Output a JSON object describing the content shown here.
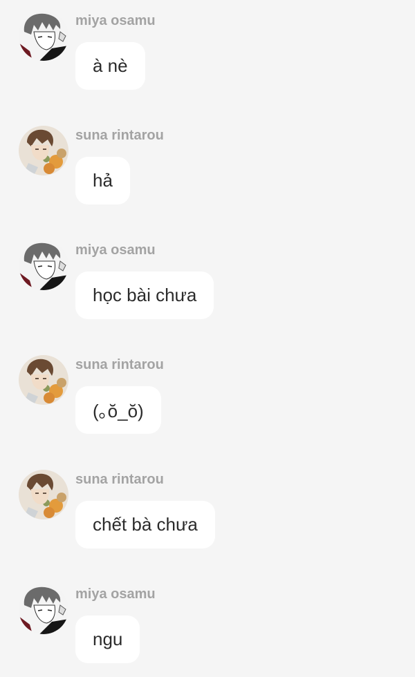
{
  "messages": [
    {
      "sender": "miya osamu",
      "avatar": "osamu-avatar",
      "text": "à nè"
    },
    {
      "sender": "suna rintarou",
      "avatar": "suna-avatar",
      "text": "hả"
    },
    {
      "sender": "miya osamu",
      "avatar": "osamu-avatar",
      "text": "học bài chưa"
    },
    {
      "sender": "suna rintarou",
      "avatar": "suna-avatar",
      "text": "(｡ŏ_ŏ)"
    },
    {
      "sender": "suna rintarou",
      "avatar": "suna-avatar",
      "text": "chết bà chưa"
    },
    {
      "sender": "miya osamu",
      "avatar": "osamu-avatar",
      "text": "ngu"
    }
  ],
  "colors": {
    "background": "#f5f5f5",
    "bubble": "#ffffff",
    "sender_name": "#a3a3a3",
    "message_text": "#2b2b2b"
  }
}
